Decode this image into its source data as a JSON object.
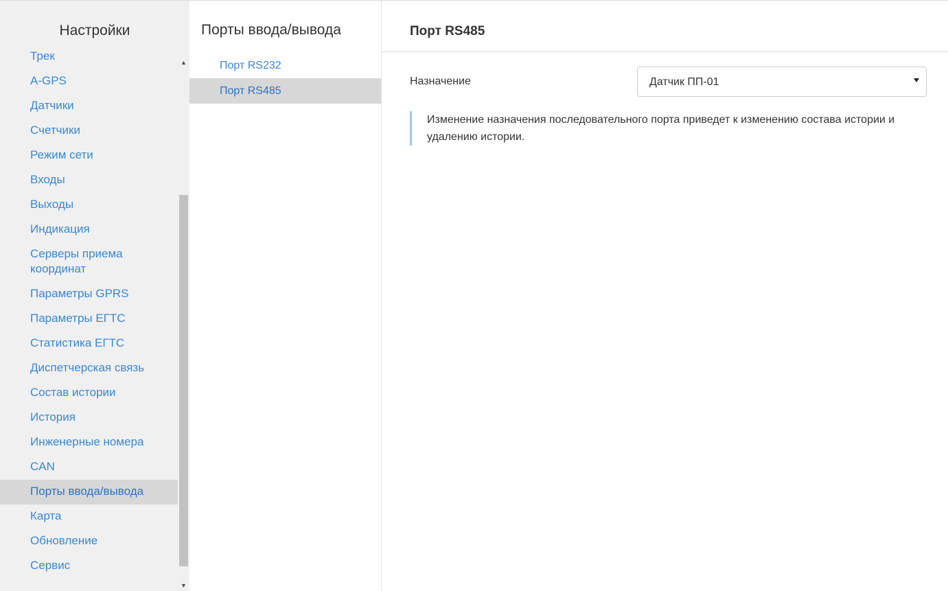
{
  "sidebar": {
    "title": "Настройки",
    "items": [
      {
        "label": "Трек"
      },
      {
        "label": "A-GPS"
      },
      {
        "label": "Датчики"
      },
      {
        "label": "Счетчики"
      },
      {
        "label": "Режим сети"
      },
      {
        "label": "Входы"
      },
      {
        "label": "Выходы"
      },
      {
        "label": "Индикация"
      },
      {
        "label": "Серверы приема координат"
      },
      {
        "label": "Параметры GPRS"
      },
      {
        "label": "Параметры ЕГТС"
      },
      {
        "label": "Статистика ЕГТС"
      },
      {
        "label": "Диспетчерская связь"
      },
      {
        "label": "Состав истории"
      },
      {
        "label": "История"
      },
      {
        "label": "Инженерные номера"
      },
      {
        "label": "CAN"
      },
      {
        "label": "Порты ввода/вывода",
        "active": true
      },
      {
        "label": "Карта"
      },
      {
        "label": "Обновление"
      },
      {
        "label": "Сервис"
      }
    ],
    "scroll_up_icon": "triangle-up-icon",
    "scroll_down_icon": "triangle-down-icon"
  },
  "subnav": {
    "title": "Порты ввода/вывода",
    "items": [
      {
        "label": "Порт RS232"
      },
      {
        "label": "Порт RS485",
        "active": true
      }
    ]
  },
  "main": {
    "title": "Порт RS485",
    "field_label": "Назначение",
    "select_value": "Датчик ПП-01",
    "select_icon": "caret-down-icon",
    "note": "Изменение назначения последовательного порта приведет к изменению состава истории и удалению истории."
  },
  "colors": {
    "link": "#3a87d4",
    "active_bg": "#d7d7d7",
    "sidebar_bg": "#f0f0f0",
    "note_border": "#9cc7ee"
  }
}
